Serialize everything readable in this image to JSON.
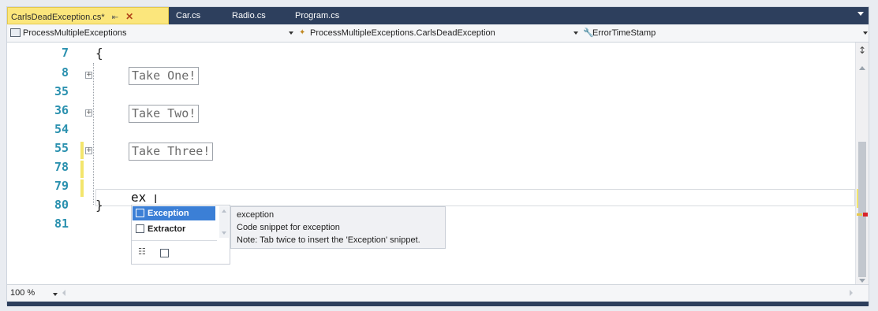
{
  "tabs": [
    {
      "label": "CarlsDeadException.cs*",
      "active": true
    },
    {
      "label": "Car.cs",
      "active": false
    },
    {
      "label": "Radio.cs",
      "active": false
    },
    {
      "label": "Program.cs",
      "active": false
    }
  ],
  "tab_pin_icon": "pin-icon",
  "tab_close_icon": "close-icon",
  "nav": {
    "project": "ProcessMultipleExceptions",
    "type": "ProcessMultipleExceptions.CarlsDeadException",
    "member": "ErrorTimeStamp"
  },
  "editor": {
    "lines": [
      {
        "num": "7",
        "code": "{"
      },
      {
        "num": "8",
        "collapsed": "Take One!"
      },
      {
        "num": "35"
      },
      {
        "num": "36",
        "collapsed": "Take Two!"
      },
      {
        "num": "54"
      },
      {
        "num": "55",
        "collapsed": "Take Three!"
      },
      {
        "num": "78"
      },
      {
        "num": "79",
        "typed": "ex"
      },
      {
        "num": "80",
        "code": "}"
      },
      {
        "num": "81"
      }
    ]
  },
  "completion": {
    "items": [
      {
        "label": "Exception",
        "selected": true
      },
      {
        "label": "Extractor",
        "selected": false
      }
    ]
  },
  "tooltip": {
    "title": "exception",
    "description": "Code snippet for exception",
    "note": "Note: Tab twice to insert the 'Exception' snippet."
  },
  "zoom": "100 %",
  "colors": {
    "tab_strip": "#2d3f5d",
    "active_tab": "#fbe67c",
    "line_numbers": "#2b91af",
    "selection": "#3b7fd6",
    "change_bar": "#f3e56c"
  }
}
